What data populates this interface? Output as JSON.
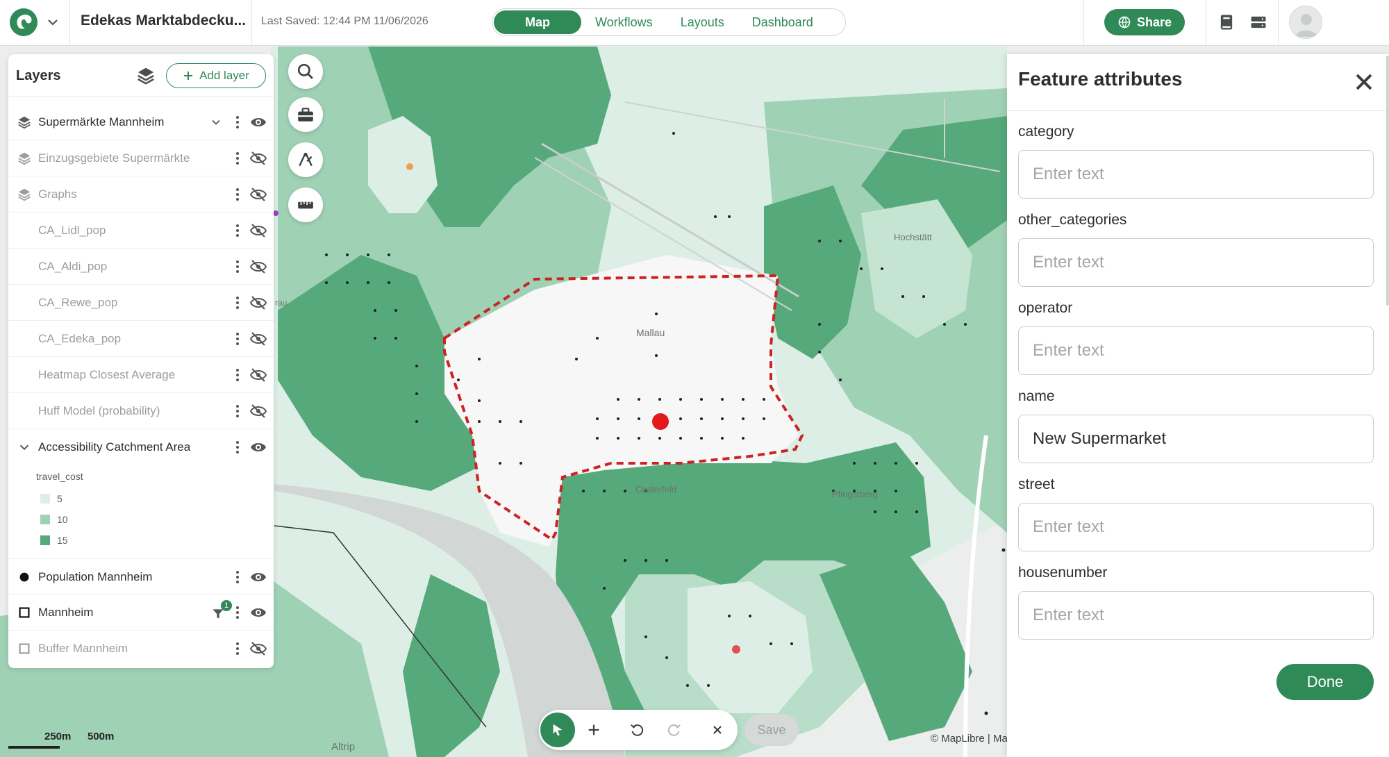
{
  "app": {
    "project_title": "Edekas Marktabdecku...",
    "last_saved": "Last Saved: 12:44 PM 11/06/2026",
    "tabs": [
      {
        "label": "Map",
        "active": true
      },
      {
        "label": "Workflows",
        "active": false
      },
      {
        "label": "Layouts",
        "active": false
      },
      {
        "label": "Dashboard",
        "active": false
      }
    ],
    "share_label": "Share",
    "icons": {
      "logo": "goat-logo-icon",
      "project_menu": "chevron-down-icon",
      "share": "globe-icon",
      "book": "book-icon",
      "list": "server-list-icon",
      "avatar": "user-avatar-icon"
    },
    "accent_color": "#2f8a58"
  },
  "layers_panel": {
    "title": "Layers",
    "add_layer_label": "Add layer",
    "layers": [
      {
        "name": "Supermärkte Mannheim",
        "type": "layer-group",
        "visible": true,
        "expandable": true
      },
      {
        "name": "Einzugsgebiete Supermärkte",
        "type": "layer-group",
        "visible": false
      },
      {
        "name": "Graphs",
        "type": "layer-group",
        "visible": false
      },
      {
        "name": "CA_Lidl_pop",
        "type": "layer",
        "visible": false
      },
      {
        "name": "CA_Aldi_pop",
        "type": "layer",
        "visible": false
      },
      {
        "name": "CA_Rewe_pop",
        "type": "layer",
        "visible": false
      },
      {
        "name": "CA_Edeka_pop",
        "type": "layer",
        "visible": false
      },
      {
        "name": "Heatmap Closest Average",
        "type": "layer",
        "visible": false
      },
      {
        "name": "Huff Model (probability)",
        "type": "layer",
        "visible": false
      },
      {
        "name": "Accessibility Catchment Area",
        "type": "layer",
        "visible": true,
        "expanded": true
      },
      {
        "name": "Population Mannheim",
        "type": "point",
        "visible": true
      },
      {
        "name": "Mannheim",
        "type": "polygon",
        "visible": true,
        "filter_count": "1"
      },
      {
        "name": "Buffer Mannheim",
        "type": "polygon",
        "visible": false
      }
    ],
    "legend": {
      "field": "travel_cost",
      "items": [
        {
          "label": "5",
          "color": "#dceee5"
        },
        {
          "label": "10",
          "color": "#9fd1b5"
        },
        {
          "label": "15",
          "color": "#56a97a"
        }
      ]
    }
  },
  "map": {
    "place_labels": [
      "Mallau",
      "Hochstätt",
      "Casterfeld",
      "Pfingstberg",
      "Altrip",
      "rau"
    ],
    "tools": [
      "search-icon",
      "toolbox-icon",
      "draw-icon",
      "ruler-icon"
    ],
    "edit_tools": [
      "select-pointer-icon",
      "add-icon",
      "undo-icon",
      "redo-icon",
      "close-icon"
    ],
    "save_label": "Save",
    "scale": {
      "label_a": "250m",
      "label_b": "500m"
    },
    "attribution": "© MapLibre | Made with GOAT | © MapTiler © OpenStreetMap contributors",
    "colors": {
      "catchment_5": "#dceee5",
      "catchment_10": "#9fd1b5",
      "catchment_15": "#56a97a",
      "boundary": "#cc2222",
      "marker": "#e3191c"
    }
  },
  "attributes_panel": {
    "title": "Feature attributes",
    "fields": [
      {
        "label": "category",
        "value": "",
        "placeholder": "Enter text"
      },
      {
        "label": "other_categories",
        "value": "",
        "placeholder": "Enter text"
      },
      {
        "label": "operator",
        "value": "",
        "placeholder": "Enter text"
      },
      {
        "label": "name",
        "value": "New Supermarket",
        "placeholder": "Enter text"
      },
      {
        "label": "street",
        "value": "",
        "placeholder": "Enter text"
      },
      {
        "label": "housenumber",
        "value": "",
        "placeholder": "Enter text"
      }
    ],
    "done_label": "Done"
  }
}
